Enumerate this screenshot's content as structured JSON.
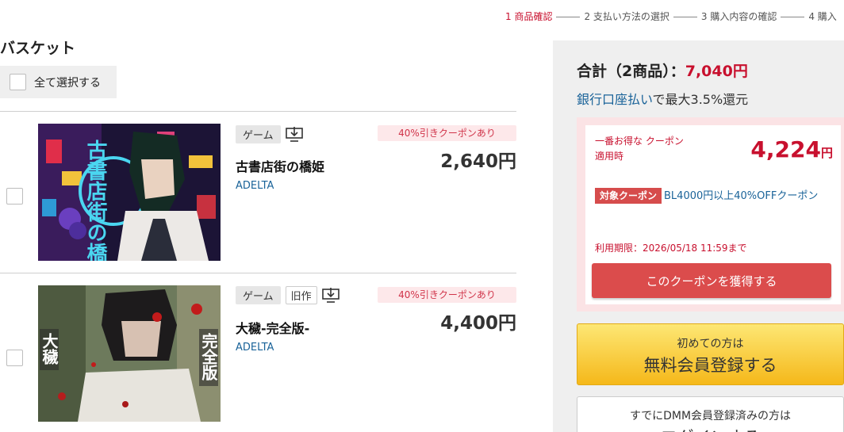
{
  "steps": [
    {
      "label": "1 商品確認",
      "active": true
    },
    {
      "label": "2 支払い方法の選択",
      "active": false
    },
    {
      "label": "3 購入内容の確認",
      "active": false
    },
    {
      "label": "4 購入",
      "active": false
    }
  ],
  "basket": {
    "title": "バスケット",
    "select_all_label": "全て選択する",
    "items": [
      {
        "tags": [
          "ゲーム"
        ],
        "coupon_badge": "40%引きクーポンあり",
        "price": "2,640円",
        "title": "古書店街の橋姫",
        "maker": "ADELTA",
        "cover_text": "古書店街の橋姫"
      },
      {
        "tags": [
          "ゲーム",
          "旧作"
        ],
        "coupon_badge": "40%引きクーポンあり",
        "price": "4,400円",
        "title": "大穢-完全版-",
        "maker": "ADELTA",
        "cover_text_left": "大穢",
        "cover_text_right": "完全版"
      }
    ]
  },
  "summary": {
    "total_label": "合計（2商品）：",
    "total_amount": "7,040円",
    "bank_link": "銀行口座払い",
    "bank_rest": "で最大3.5%還元",
    "coupon": {
      "best_label": "一番お得な クーポン適用時",
      "best_price": "4,224",
      "best_price_unit": "円",
      "target_tag": "対象クーポン",
      "target_name": "BL4000円以上40%OFFクーポン",
      "expiry": "利用期限：2026/05/18 11:59まで",
      "button": "このクーポンを獲得する"
    },
    "register": {
      "sub": "初めての方は",
      "main": "無料会員登録する"
    },
    "login": {
      "sub": "すでにDMM会員登録済みの方は",
      "main": "ログインする"
    }
  },
  "colors": {
    "accent_red": "#c8102e",
    "link_blue": "#1a6399",
    "cta_yellow": "#f5b81a"
  }
}
